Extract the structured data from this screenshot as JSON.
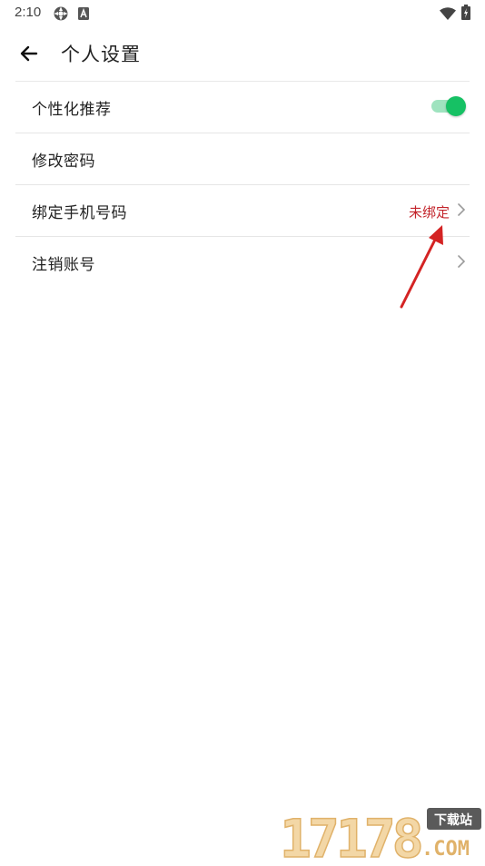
{
  "status_bar": {
    "time": "2:10",
    "icons": [
      "gear-icon",
      "a-badge-icon",
      "wifi-icon",
      "battery-icon"
    ]
  },
  "header": {
    "title": "个人设置",
    "back_icon": "arrow-left-icon"
  },
  "settings": [
    {
      "label": "个性化推荐",
      "control": "toggle",
      "toggle_on": true
    },
    {
      "label": "修改密码"
    },
    {
      "label": "绑定手机号码",
      "value": "未绑定",
      "chevron": true
    },
    {
      "label": "注销账号",
      "chevron": true
    }
  ],
  "colors": {
    "accent_green": "#16c164",
    "toggle_track": "#9fe3bf",
    "value_red": "#c3242b",
    "annotation_red": "#d42323"
  },
  "watermark": {
    "brand": "17178",
    "badge": "下载站",
    "domain": ".COM"
  }
}
